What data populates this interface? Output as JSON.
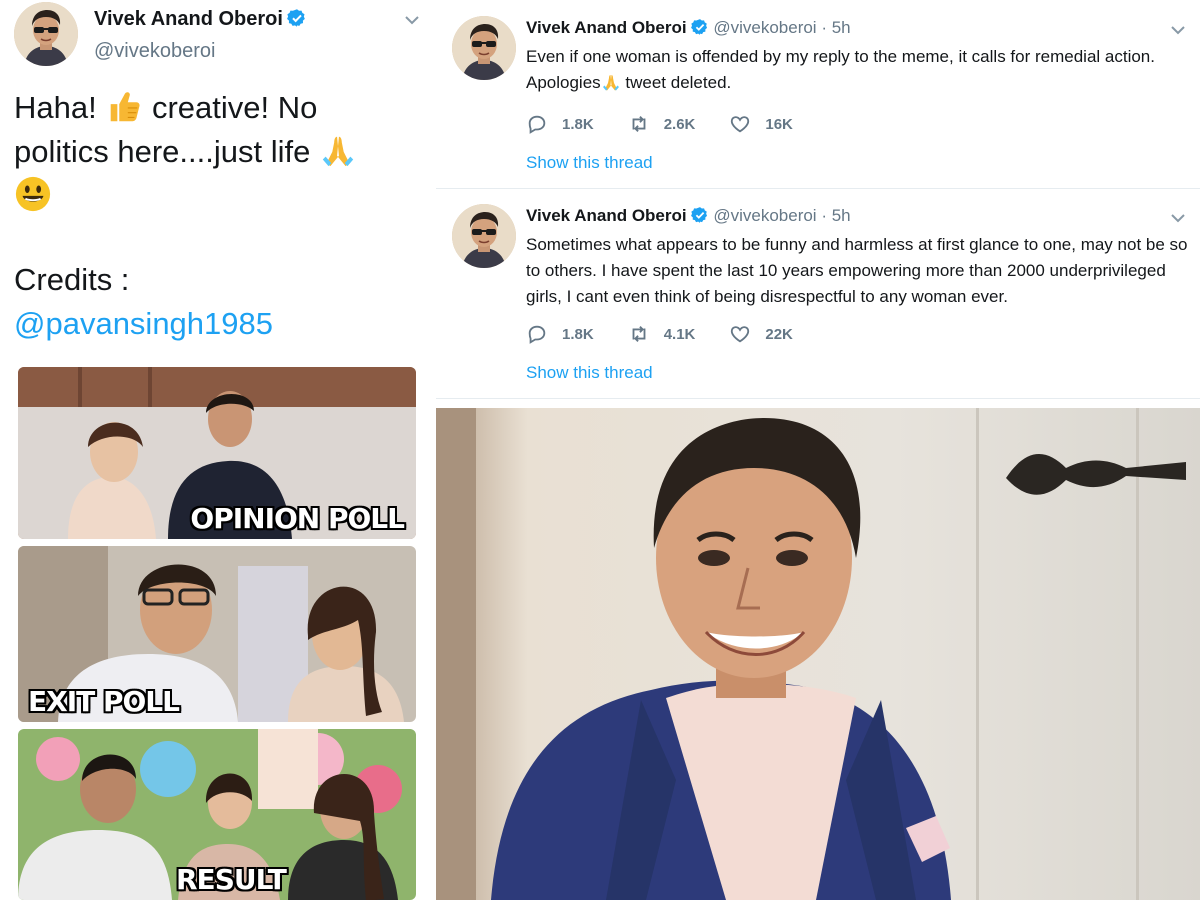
{
  "left_tweet": {
    "name": "Vivek Anand Oberoi",
    "handle": "@vivekoberoi",
    "text_line1": "Haha! ",
    "text_line1b": " creative! No",
    "text_line2": "politics here....just life ",
    "credits": "Credits :",
    "mention": "@pavansingh1985",
    "meme_panels": [
      "OPINION POLL",
      "EXIT POLL",
      "RESULT"
    ]
  },
  "tweets": [
    {
      "name": "Vivek Anand Oberoi",
      "handle": "@vivekoberoi",
      "time": "· 5h",
      "text_part1": "Even if one woman is offended by my reply to the meme, it calls for remedial action. Apologies",
      "text_part2": " tweet deleted.",
      "replies": "1.8K",
      "retweets": "2.6K",
      "likes": "16K",
      "show_thread": "Show this thread"
    },
    {
      "name": "Vivek Anand Oberoi",
      "handle": "@vivekoberoi",
      "time": "· 5h",
      "text": "Sometimes what appears to be funny and harmless at first glance to one, may not be so to others. I have spent the last 10 years empowering more than 2000 underprivileged girls, I cant even think of being disrespectful to any woman ever.",
      "replies": "1.8K",
      "retweets": "4.1K",
      "likes": "22K",
      "show_thread": "Show this thread"
    }
  ],
  "colors": {
    "link": "#1da1f2",
    "meta": "#657786",
    "verified": "#1da1f2"
  },
  "icons": [
    "verified-icon",
    "chevron-down-icon",
    "reply-icon",
    "retweet-icon",
    "like-icon",
    "thumbs-up-emoji",
    "folded-hands-emoji",
    "smiley-emoji"
  ]
}
